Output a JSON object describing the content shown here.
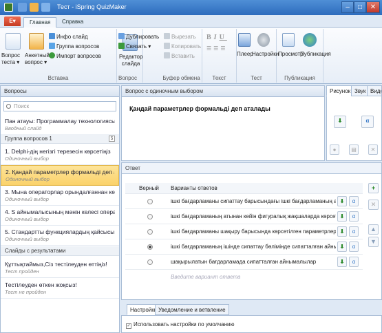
{
  "window": {
    "title": "Тест - iSpring QuizMaker",
    "minimize": "–",
    "maximize": "□",
    "close": "✕"
  },
  "tabs": {
    "file": "E▾",
    "home": "Главная",
    "help": "Справка"
  },
  "ribbon": {
    "test_question": "Вопрос",
    "test_question_sub": "теста ▾",
    "survey_question": "Анкетный",
    "survey_question_sub": "вопрос ▾",
    "info_slide": "Инфо слайд",
    "question_group": "Группа вопросов",
    "import_questions": "Импорт вопросов",
    "group_insert": "Вставка",
    "slide_editor": "Редактор",
    "slide_editor_sub": "слайда",
    "duplicate": "Дублировать",
    "link": "Связать ▾",
    "group_question": "Вопрос",
    "cut": "Вырезать",
    "copy": "Копировать",
    "paste": "Вставить",
    "group_clipboard": "Буфер обмена",
    "group_text": "Текст",
    "player": "Плеер",
    "settings": "Настройки",
    "group_test": "Тест",
    "preview": "Просмотр",
    "publish": "Публикация",
    "group_publish": "Публикация"
  },
  "left": {
    "header": "Вопросы",
    "search_placeholder": "Поиск",
    "intro": {
      "title": "Пан атауы: Программалау технологиясы ...",
      "sub": "Вводный слайд"
    },
    "group_label": "Группа вопросов 1",
    "group_badge": "5",
    "questions": [
      {
        "title": "1. Delphi-дің негізгі терезесін көрсетіңіз",
        "sub": "Одиночный выбор"
      },
      {
        "title": "2. Қандай параметрлер формальді деп ат...",
        "sub": "Одиночный выбор"
      },
      {
        "title": "3. Мына операторлар орындалғаннан кейі...",
        "sub": "Одиночный выбор"
      },
      {
        "title": "4. S айнымалысының мәнін келесі операт...",
        "sub": "Одиночный выбор"
      },
      {
        "title": "5. Стандартты функциялардың қайсысы Y...",
        "sub": "Одиночный выбор"
      }
    ],
    "results_label": "Слайды с результатами",
    "results": [
      {
        "title": "Құттықтаймыз,Сіз тестілеуден өттіңіз!",
        "sub": "Тест пройден"
      },
      {
        "title": "Тестілеуден өткен жоқсыз!",
        "sub": "Тест не пройден"
      }
    ]
  },
  "question": {
    "header": "Вопрос с одиночным выбором",
    "text": "Қандай параметрлер формальді деп аталады"
  },
  "media_tabs": [
    "Рисунок",
    "Звук",
    "Видео"
  ],
  "answers": {
    "header": "Ответ",
    "col_correct": "Верный",
    "col_options": "Варианты ответов",
    "rows": [
      {
        "text": "ішкі бағдарламаны сипаттау барысындағы ішкі бағдарламаның аты",
        "selected": false
      },
      {
        "text": "ішкі бағдарламаның атынан кейін фигуралық жақшаларда көрсетілген",
        "selected": false
      },
      {
        "text": "ішкі бағдарламаны шақыру барысында көрсетілген параметрлер",
        "selected": false
      },
      {
        "text": "ішкі бағдарламаның ішінде сипаттау бөлімінде сипатталған айнымалылар",
        "selected": true
      },
      {
        "text": "шақырылатын бағдарламада сипатталған айнымалылар",
        "selected": false
      }
    ],
    "placeholder": "Введите вариант ответа"
  },
  "bottom": {
    "tab_settings": "Настройки",
    "tab_feedback": "Уведомление и ветвление",
    "default_settings": "Использовать настройки по умолчанию"
  },
  "colors": {
    "title_bar": "#2d6cbd",
    "selected_slide": "#fbd26a",
    "accent_green": "#2e8b2e"
  }
}
